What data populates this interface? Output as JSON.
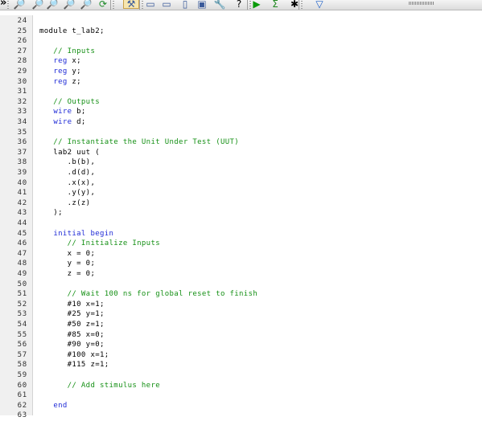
{
  "toolbar": {
    "overflow_glyph": "»",
    "buttons": [
      {
        "name": "find-icon",
        "glyph": "🔎"
      },
      {
        "name": "find-next-icon",
        "glyph": "🔎"
      },
      {
        "name": "find-in-files-icon",
        "glyph": "🔎"
      },
      {
        "name": "find-previous-icon",
        "glyph": "🔎"
      },
      {
        "name": "find-replace-icon",
        "glyph": "🔎"
      },
      {
        "name": "refresh-icon",
        "glyph": "⟳"
      },
      {
        "name": "process-icon",
        "glyph": "⚒"
      },
      {
        "name": "window-cascade-icon",
        "glyph": "▭"
      },
      {
        "name": "window-tile-horizontal-icon",
        "glyph": "▭"
      },
      {
        "name": "window-tile-vertical-icon",
        "glyph": "▯"
      },
      {
        "name": "window-icon",
        "glyph": "▣"
      },
      {
        "name": "wrench-icon",
        "glyph": "🔧"
      },
      {
        "name": "help-cursor-icon",
        "glyph": "?"
      },
      {
        "name": "run-icon",
        "glyph": "▶"
      },
      {
        "name": "sigma-icon",
        "glyph": "Σ"
      },
      {
        "name": "step-icon",
        "glyph": "✱"
      },
      {
        "name": "filter-icon",
        "glyph": "▽"
      }
    ]
  },
  "editor": {
    "colors": {
      "keyword": "#1f2bd6",
      "comment": "#159015",
      "text": "#000000"
    },
    "lines": [
      {
        "n": "24",
        "parts": []
      },
      {
        "n": "25",
        "parts": [
          {
            "t": "module t_lab2;",
            "c": "plain"
          }
        ]
      },
      {
        "n": "26",
        "parts": []
      },
      {
        "n": "27",
        "parts": [
          {
            "t": "   // Inputs",
            "c": "comment"
          }
        ]
      },
      {
        "n": "28",
        "parts": [
          {
            "t": "   ",
            "c": "plain"
          },
          {
            "t": "reg",
            "c": "kw"
          },
          {
            "t": " x;",
            "c": "plain"
          }
        ]
      },
      {
        "n": "29",
        "parts": [
          {
            "t": "   ",
            "c": "plain"
          },
          {
            "t": "reg",
            "c": "kw"
          },
          {
            "t": " y;",
            "c": "plain"
          }
        ]
      },
      {
        "n": "30",
        "parts": [
          {
            "t": "   ",
            "c": "plain"
          },
          {
            "t": "reg",
            "c": "kw"
          },
          {
            "t": " z;",
            "c": "plain"
          }
        ]
      },
      {
        "n": "31",
        "parts": []
      },
      {
        "n": "32",
        "parts": [
          {
            "t": "   // Outputs",
            "c": "comment"
          }
        ]
      },
      {
        "n": "33",
        "parts": [
          {
            "t": "   ",
            "c": "plain"
          },
          {
            "t": "wire",
            "c": "kw"
          },
          {
            "t": " b;",
            "c": "plain"
          }
        ]
      },
      {
        "n": "34",
        "parts": [
          {
            "t": "   ",
            "c": "plain"
          },
          {
            "t": "wire",
            "c": "kw"
          },
          {
            "t": " d;",
            "c": "plain"
          }
        ]
      },
      {
        "n": "35",
        "parts": []
      },
      {
        "n": "36",
        "parts": [
          {
            "t": "   // Instantiate the Unit Under Test (UUT)",
            "c": "comment"
          }
        ]
      },
      {
        "n": "37",
        "parts": [
          {
            "t": "   lab2 uut (",
            "c": "plain"
          }
        ]
      },
      {
        "n": "38",
        "parts": [
          {
            "t": "      .b(b),",
            "c": "plain"
          }
        ]
      },
      {
        "n": "39",
        "parts": [
          {
            "t": "      .d(d),",
            "c": "plain"
          }
        ]
      },
      {
        "n": "40",
        "parts": [
          {
            "t": "      .x(x),",
            "c": "plain"
          }
        ]
      },
      {
        "n": "41",
        "parts": [
          {
            "t": "      .y(y),",
            "c": "plain"
          }
        ]
      },
      {
        "n": "42",
        "parts": [
          {
            "t": "      .z(z)",
            "c": "plain"
          }
        ]
      },
      {
        "n": "43",
        "parts": [
          {
            "t": "   );",
            "c": "plain"
          }
        ]
      },
      {
        "n": "44",
        "parts": []
      },
      {
        "n": "45",
        "parts": [
          {
            "t": "   ",
            "c": "plain"
          },
          {
            "t": "initial begin",
            "c": "kw"
          }
        ]
      },
      {
        "n": "46",
        "parts": [
          {
            "t": "      // Initialize Inputs",
            "c": "comment"
          }
        ]
      },
      {
        "n": "47",
        "parts": [
          {
            "t": "      x = 0;",
            "c": "plain"
          }
        ]
      },
      {
        "n": "48",
        "parts": [
          {
            "t": "      y = 0;",
            "c": "plain"
          }
        ]
      },
      {
        "n": "49",
        "parts": [
          {
            "t": "      z = 0;",
            "c": "plain"
          }
        ]
      },
      {
        "n": "50",
        "parts": []
      },
      {
        "n": "51",
        "parts": [
          {
            "t": "      // Wait 100 ns for global reset to finish",
            "c": "comment"
          }
        ]
      },
      {
        "n": "52",
        "parts": [
          {
            "t": "      #10 x=1;",
            "c": "plain"
          }
        ]
      },
      {
        "n": "53",
        "parts": [
          {
            "t": "      #25 y=1;",
            "c": "plain"
          }
        ]
      },
      {
        "n": "54",
        "parts": [
          {
            "t": "      #50 z=1;",
            "c": "plain"
          }
        ]
      },
      {
        "n": "55",
        "parts": [
          {
            "t": "      #85 x=0;",
            "c": "plain"
          }
        ]
      },
      {
        "n": "56",
        "parts": [
          {
            "t": "      #90 y=0;",
            "c": "plain"
          }
        ]
      },
      {
        "n": "57",
        "parts": [
          {
            "t": "      #100 x=1;",
            "c": "plain"
          }
        ]
      },
      {
        "n": "58",
        "parts": [
          {
            "t": "      #115 z=1;",
            "c": "plain"
          }
        ]
      },
      {
        "n": "59",
        "parts": []
      },
      {
        "n": "60",
        "parts": [
          {
            "t": "      // Add stimulus here",
            "c": "comment"
          }
        ]
      },
      {
        "n": "61",
        "parts": []
      },
      {
        "n": "62",
        "parts": [
          {
            "t": "   ",
            "c": "plain"
          },
          {
            "t": "end",
            "c": "kw"
          }
        ]
      },
      {
        "n": "63",
        "parts": []
      }
    ]
  }
}
